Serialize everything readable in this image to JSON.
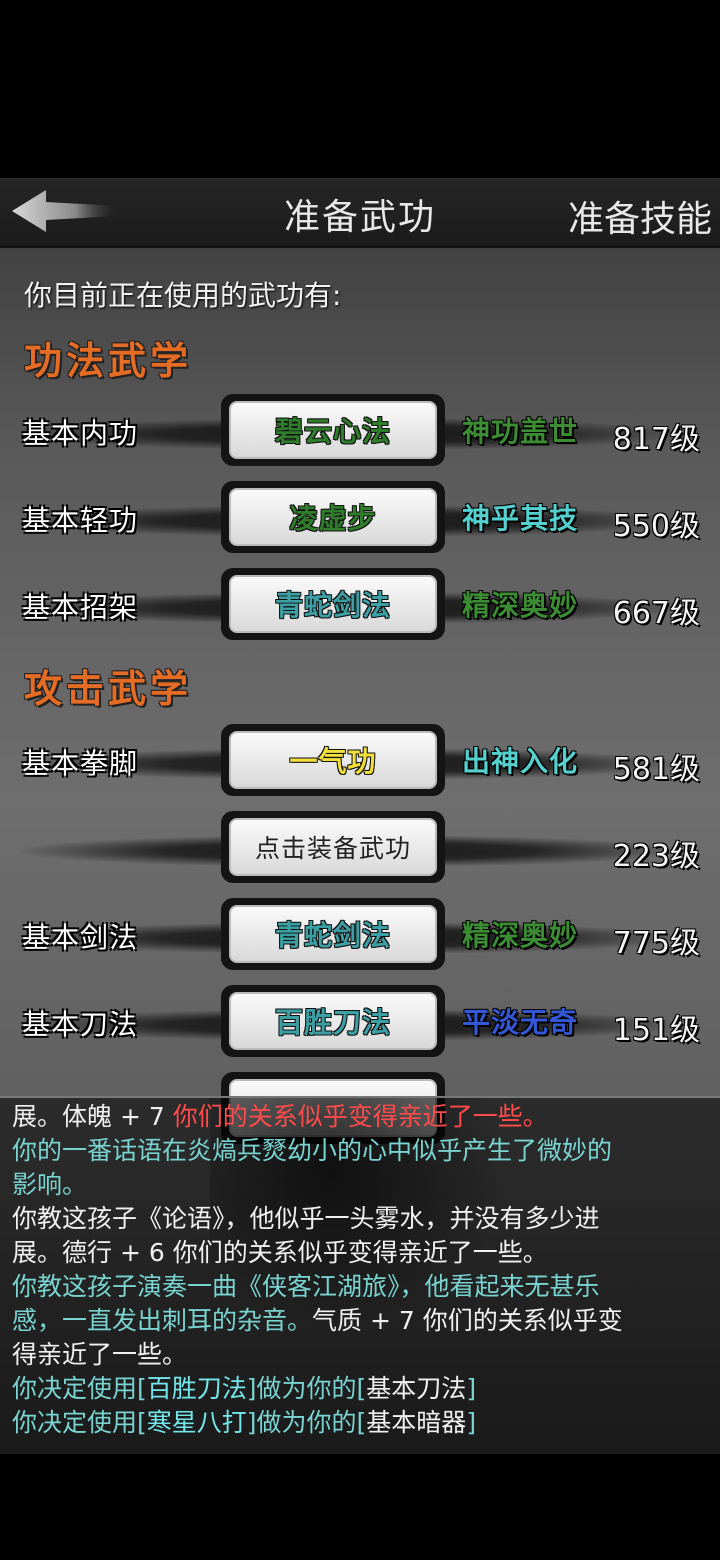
{
  "header": {
    "title": "准备武功",
    "skills_tab": "准备技能"
  },
  "intro": "你目前正在使用的武功有:",
  "sections": {
    "neigong_title": "功法武学",
    "attack_title": "攻击武学"
  },
  "rows": [
    {
      "label": "基本内功",
      "skill": "碧云心法",
      "skill_color": "#2f7d2b",
      "grade": "神功盖世",
      "grade_color": "#3c8c34",
      "level": "817级"
    },
    {
      "label": "基本轻功",
      "skill": "凌虚步",
      "skill_color": "#2f7d2b",
      "grade": "神乎其技",
      "grade_color": "#54d0cf",
      "level": "550级"
    },
    {
      "label": "基本招架",
      "skill": "青蛇剑法",
      "skill_color": "#3b9fa3",
      "grade": "精深奥妙",
      "grade_color": "#3c8c34",
      "level": "667级"
    },
    {
      "label": "基本拳脚",
      "skill": "一气功",
      "skill_color": "#f4e03a",
      "grade": "出神入化",
      "grade_color": "#54d0cf",
      "level": "581级"
    },
    {
      "label": "",
      "skill": "点击装备武功",
      "skill_color": "#222222",
      "grade": "",
      "grade_color": "#ffffff",
      "level": "223级"
    },
    {
      "label": "基本剑法",
      "skill": "青蛇剑法",
      "skill_color": "#3b9fa3",
      "grade": "精深奥妙",
      "grade_color": "#3c8c34",
      "level": "775级"
    },
    {
      "label": "基本刀法",
      "skill": "百胜刀法",
      "skill_color": "#3b9fa3",
      "grade": "平淡无奇",
      "grade_color": "#3457d6",
      "level": "151级"
    }
  ],
  "log": {
    "l1_a": "展。体魄 + 7 ",
    "l1_b": "你们的关系似乎变得亲近了一些。",
    "l2": "你的一番话语在炎熇兵燹幼小的心中似乎产生了微妙的",
    "l3": "影响。",
    "l4": "你教这孩子《论语》，他似乎一头雾水，并没有多少进",
    "l5": "展。德行 + 6 你们的关系似乎变得亲近了一些。",
    "l6": "你教这孩子演奏一曲《侠客江湖旅》，他看起来无甚乐",
    "l7_a": "感，一直发出刺耳的杂音。",
    "l7_b": "气质 + 7 你们的关系似乎变",
    "l8": "得亲近了一些。",
    "l9_a": "你决定使用[",
    "l9_b": "百胜刀法",
    "l9_c": "]做为你的[",
    "l9_d": "基本刀法",
    "l9_e": "]",
    "l10_a": "你决定使用[",
    "l10_b": "寒星八打",
    "l10_c": "]做为你的[",
    "l10_d": "基本暗器",
    "l10_e": "]"
  }
}
